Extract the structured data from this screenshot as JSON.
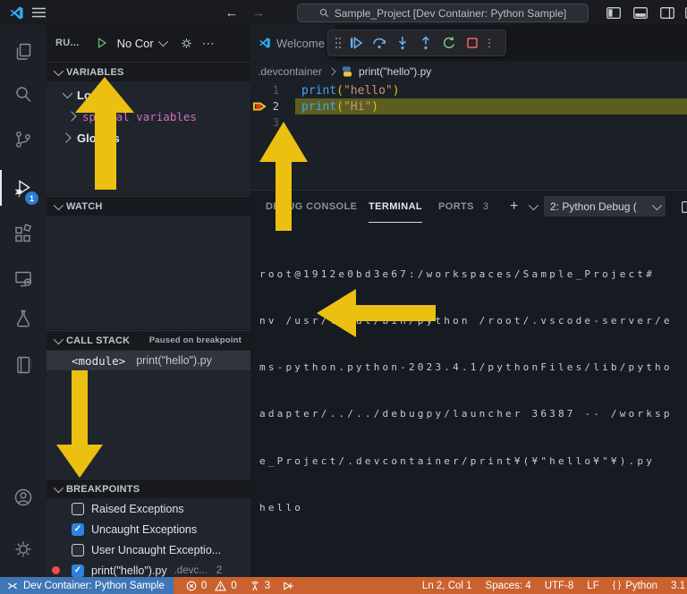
{
  "colors": {
    "annotation_yellow": "#ecc011",
    "status_debug_bg": "#c9622f",
    "remote_bg": "#3f76b6",
    "badge_blue": "#2d7bd4",
    "breakpoint_red": "#f14c4c",
    "current_line_bg": "#5c5e1f",
    "string_orange": "#ce9178",
    "function_blue": "#41a4f5"
  },
  "icons": {
    "back_arrow": "←",
    "forward_arrow": "→",
    "more_horizontal": "⋯",
    "more_vertical": "⋮",
    "check": "✓",
    "braces": "{ }"
  },
  "title_bar": {
    "search_value": "Sample_Project [Dev Container: Python Sample]"
  },
  "activity_bar": {
    "debug_badge": "1"
  },
  "sidebar": {
    "header": {
      "title": "RU...",
      "config": "No Cor"
    },
    "variables": {
      "title": "VARIABLES",
      "locals": "Locals",
      "special": "special variables",
      "globals": "Globals"
    },
    "watch": {
      "title": "WATCH"
    },
    "call_stack": {
      "title": "CALL STACK",
      "status": "Paused on breakpoint",
      "frame_name": "<module>",
      "frame_file": "print(\"hello\").py"
    },
    "breakpoints": {
      "title": "BREAKPOINTS",
      "items": [
        {
          "label": "Raised Exceptions",
          "checked": false
        },
        {
          "label": "Uncaught Exceptions",
          "checked": true
        },
        {
          "label": "User Uncaught Exceptio...",
          "checked": false
        },
        {
          "label": "print(\"hello\").py",
          "path": ".devc...",
          "line": "2",
          "checked": true
        }
      ]
    }
  },
  "editor": {
    "tab_label": "Welcome",
    "breadcrumb": {
      "folder": ".devcontainer",
      "file": "print(\"hello\").py"
    },
    "code": {
      "line1": {
        "num": "1",
        "fn": "print",
        "open": "(",
        "str": "\"hello\"",
        "close": ")"
      },
      "line2": {
        "num": "2",
        "fn": "print",
        "open": "(",
        "str": "\"Hi\"",
        "close": ")"
      },
      "line3": {
        "num": "3"
      }
    }
  },
  "panel": {
    "tabs": {
      "debug_console": "DEBUG CONSOLE",
      "terminal": "TERMINAL",
      "ports": "PORTS",
      "ports_badge": "3"
    },
    "terminal_select": "2: Python Debug (",
    "terminal_lines": [
      "root@1912e0bd3e67:/workspaces/Sample_Project#",
      "nv /usr/local/bin/python /root/.vscode-server/e",
      "ms-python.python-2023.4.1/pythonFiles/lib/pytho",
      "adapter/../../debugpy/launcher 36387 -- /worksp",
      "e_Project/.devcontainer/print¥(¥\"hello¥\"¥).py",
      "hello"
    ]
  },
  "status_bar": {
    "remote": "Dev Container: Python Sample",
    "errors": "0",
    "warnings": "0",
    "ports": "3",
    "line_col": "Ln 2, Col 1",
    "spaces": "Spaces: 4",
    "encoding": "UTF-8",
    "eol": "LF",
    "language": "Python",
    "version": "3.1"
  }
}
